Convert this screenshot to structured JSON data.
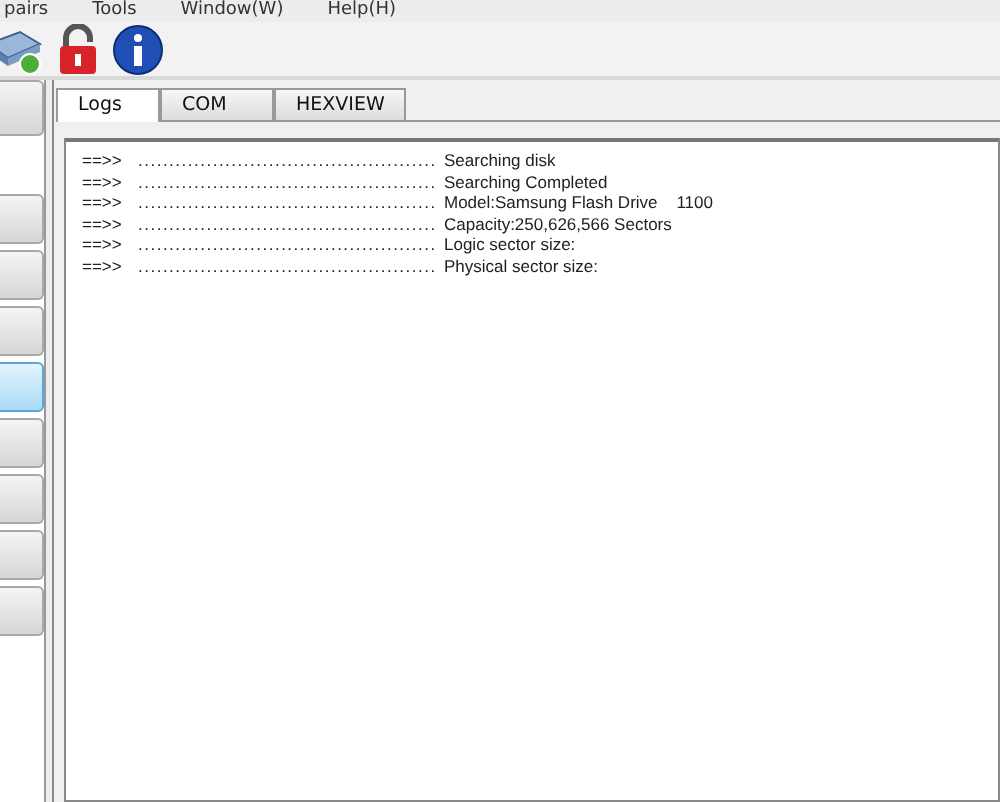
{
  "menu_bar": {
    "items": [
      "pairs",
      "Tools",
      "Window(W)",
      "Help(H)"
    ]
  },
  "toolbar": {
    "buttons": [
      {
        "kind": "drive"
      },
      {
        "kind": "lock"
      },
      {
        "kind": "info"
      }
    ]
  },
  "sidebar": {
    "items": [
      {
        "selected": false
      },
      {
        "selected": false
      },
      {
        "selected": false
      },
      {
        "selected": false
      },
      {
        "selected": true
      },
      {
        "selected": false
      },
      {
        "selected": false
      },
      {
        "selected": false
      },
      {
        "selected": false
      }
    ]
  },
  "tabs": [
    {
      "label": "Logs",
      "selected": true
    },
    {
      "label": "COM",
      "selected": false
    },
    {
      "label": "HEXVIEW",
      "selected": false
    }
  ],
  "log": {
    "lines": [
      {
        "prefix": "==>>",
        "leader": "................................................",
        "message": "Searching disk"
      },
      {
        "prefix": "==>>",
        "leader": "................................................",
        "message": "Searching Completed"
      },
      {
        "prefix": "==>>",
        "leader": "................................................",
        "message": "Model:Samsung Flash Drive    1100"
      },
      {
        "prefix": "==>>",
        "leader": "................................................",
        "message": "Capacity:250,626,566 Sectors"
      },
      {
        "prefix": "==>>",
        "leader": "................................................",
        "message": "Logic sector size:"
      },
      {
        "prefix": "==>>",
        "leader": "................................................",
        "message": "Physical sector size:"
      }
    ]
  }
}
